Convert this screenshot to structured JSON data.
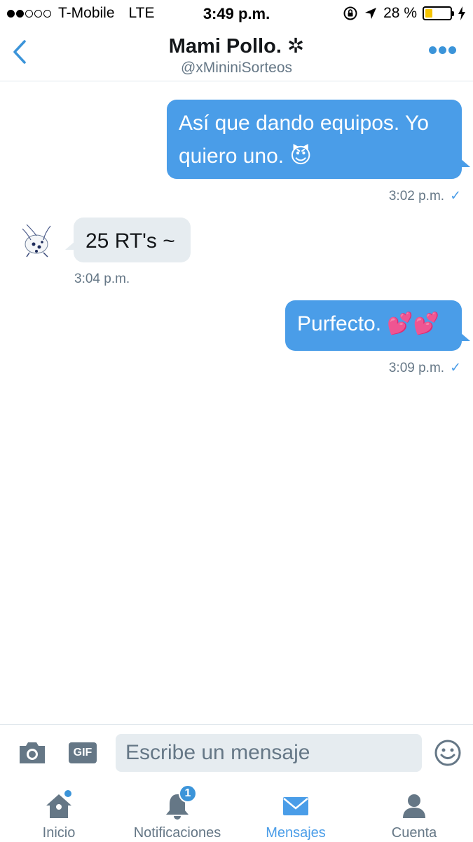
{
  "status_bar": {
    "carrier": "T-Mobile",
    "network": "LTE",
    "time": "3:49 p.m.",
    "battery_percent": "28 %",
    "battery_level": 0.28,
    "signal_bars_filled": 2,
    "signal_bars_total": 5
  },
  "header": {
    "name": "Mami Pollo. ✲",
    "handle": "@xMininiSorteos"
  },
  "messages": [
    {
      "direction": "sent",
      "text": "Así que dando equipos. Yo quiero uno. 😈",
      "line1": "Así que dando equipos. Yo",
      "line2": "quiero uno. 😈",
      "time": "3:02 p.m.",
      "status": "✓"
    },
    {
      "direction": "received",
      "text": "25 RT's ~",
      "time": "3:04 p.m."
    },
    {
      "direction": "sent",
      "text": "Purfecto. 💕💕",
      "time": "3:09 p.m.",
      "status": "✓"
    }
  ],
  "composer": {
    "placeholder": "Escribe un mensaje",
    "gif_label": "GIF"
  },
  "tabs": [
    {
      "label": "Inicio",
      "icon": "home-icon",
      "active": false,
      "dot": true
    },
    {
      "label": "Notificaciones",
      "icon": "bell-icon",
      "active": false,
      "badge": "1"
    },
    {
      "label": "Mensajes",
      "icon": "envelope-icon",
      "active": true
    },
    {
      "label": "Cuenta",
      "icon": "person-icon",
      "active": false
    }
  ],
  "colors": {
    "accent": "#4a9de8",
    "sent_bubble": "#4a9de8",
    "received_bubble": "#e6ecf0",
    "secondary_text": "#657786",
    "battery": "#f5c400"
  }
}
